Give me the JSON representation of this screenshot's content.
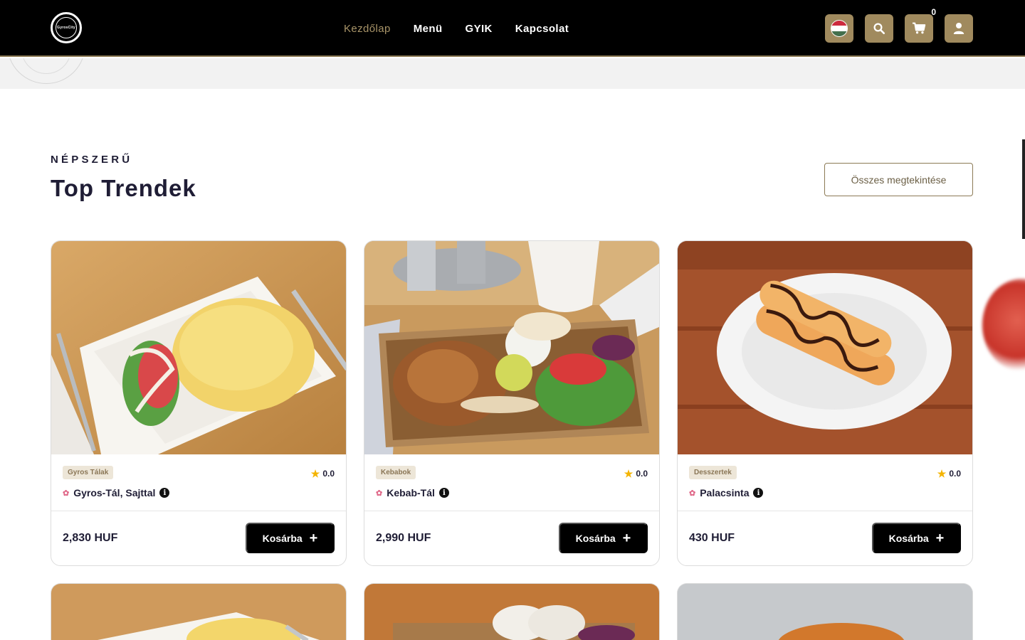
{
  "header": {
    "logo_text": "GyrosCity",
    "nav": [
      {
        "label": "Kezdőlap",
        "active": true
      },
      {
        "label": "Menü",
        "active": false
      },
      {
        "label": "GYIK",
        "active": false
      },
      {
        "label": "Kapcsolat",
        "active": false
      }
    ],
    "actions": {
      "language_icon": "hungary-flag-icon",
      "search_icon": "search-icon",
      "cart_icon": "cart-icon",
      "cart_count": "0",
      "user_icon": "user-icon"
    },
    "accent_color": "#a08a5e"
  },
  "section": {
    "eyebrow": "NÉPSZERŰ",
    "title": "Top Trendek",
    "view_all": "Összes megtekintése"
  },
  "products": [
    {
      "category": "Gyros Tálak",
      "name": "Gyros-Tál, Sajttal",
      "rating": "0.0",
      "price": "2,830 HUF",
      "button": "Kosárba"
    },
    {
      "category": "Kebabok",
      "name": "Kebab-Tál",
      "rating": "0.0",
      "price": "2,990 HUF",
      "button": "Kosárba"
    },
    {
      "category": "Desszertek",
      "name": "Palacsinta",
      "rating": "0.0",
      "price": "430 HUF",
      "button": "Kosárba"
    }
  ]
}
